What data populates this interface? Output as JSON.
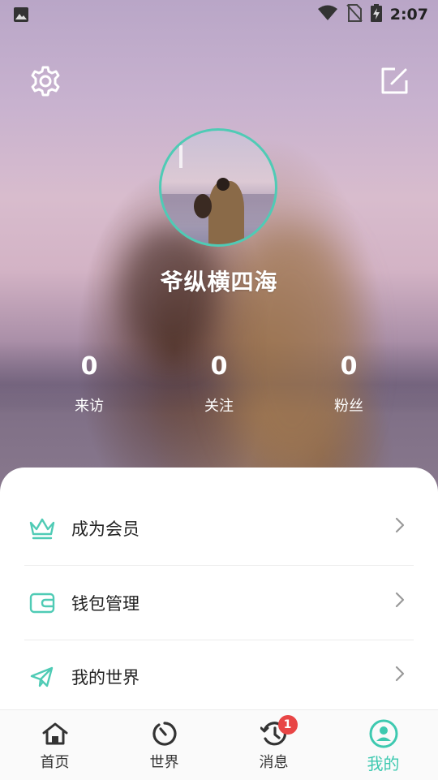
{
  "status_bar": {
    "time": "2:07",
    "icons": [
      "image-icon",
      "wifi-icon",
      "no-sim-icon",
      "battery-charging-icon"
    ]
  },
  "header": {
    "settings_icon": "gear-icon",
    "edit_icon": "edit-icon"
  },
  "profile": {
    "username": "爷纵横四海",
    "stats": [
      {
        "value": "0",
        "label": "来访"
      },
      {
        "value": "0",
        "label": "关注"
      },
      {
        "value": "0",
        "label": "粉丝"
      }
    ]
  },
  "menu": [
    {
      "label": "成为会员",
      "icon": "crown-icon"
    },
    {
      "label": "钱包管理",
      "icon": "wallet-icon"
    },
    {
      "label": "我的世界",
      "icon": "paper-plane-icon"
    }
  ],
  "bottom_nav": [
    {
      "label": "首页",
      "icon": "home-icon"
    },
    {
      "label": "世界",
      "icon": "timer-icon"
    },
    {
      "label": "消息",
      "icon": "history-icon",
      "badge": "1"
    },
    {
      "label": "我的",
      "icon": "user-circle-icon",
      "active": true
    }
  ],
  "colors": {
    "accent": "#3ec9b0",
    "badge": "#e84545"
  }
}
